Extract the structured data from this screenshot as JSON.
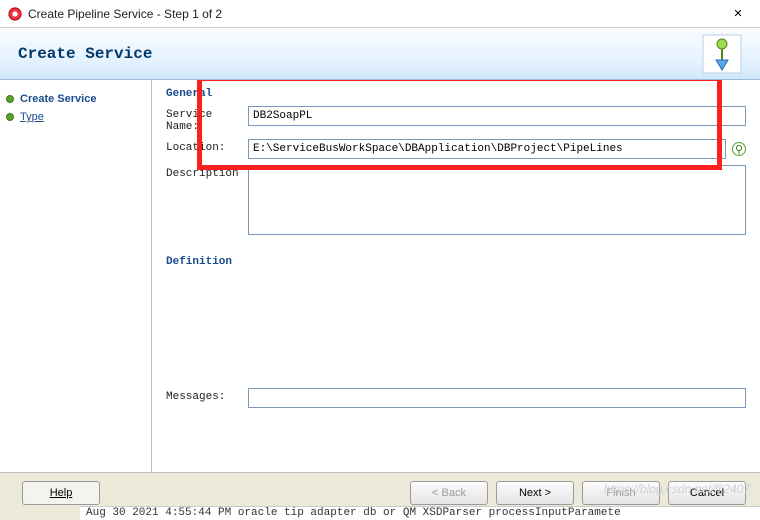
{
  "window": {
    "title": "Create Pipeline Service - Step 1 of 2",
    "close_symbol": "✕"
  },
  "banner": {
    "title": "Create Service"
  },
  "sidebar": {
    "items": [
      {
        "label": "Create Service",
        "current": true
      },
      {
        "label": "Type",
        "current": false
      }
    ]
  },
  "form": {
    "general_title": "General",
    "service_name_label": "Service Name:",
    "service_name_value": "DB2SoapPL",
    "location_label": "Location:",
    "location_value": "E:\\ServiceBusWorkSpace\\DBApplication\\DBProject\\PipeLines",
    "description_label": "Description",
    "description_value": "",
    "definition_title": "Definition",
    "messages_label": "Messages:",
    "messages_value": ""
  },
  "buttons": {
    "help": "Help",
    "back": "< Back",
    "next": "Next >",
    "finish": "Finish",
    "cancel": "Cancel"
  },
  "status": "Aug 30  2021 4:55:44 PM oracle tip adapter db or QM XSDParser processInputParamete",
  "watermark": "https://blog.csdn.net/flj2407"
}
